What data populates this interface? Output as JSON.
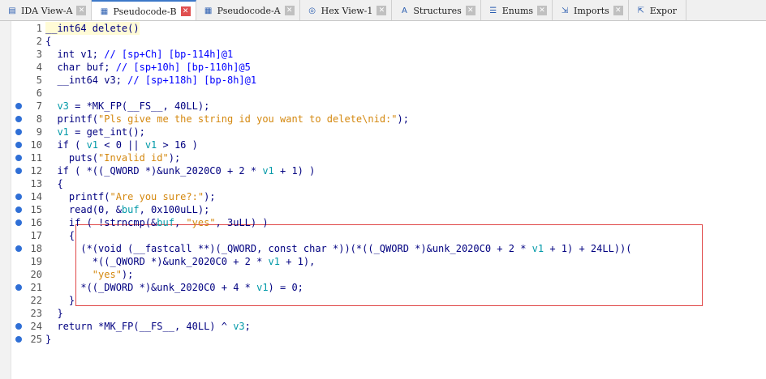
{
  "tabs": [
    {
      "label": "IDA View-A",
      "icon": "ida-view-icon",
      "glyph": "▤",
      "active": false
    },
    {
      "label": "Pseudocode-B",
      "icon": "pseudocode-icon",
      "glyph": "▦",
      "active": true
    },
    {
      "label": "Pseudocode-A",
      "icon": "pseudocode-icon",
      "glyph": "▦",
      "active": false
    },
    {
      "label": "Hex View-1",
      "icon": "hex-view-icon",
      "glyph": "◎",
      "active": false
    },
    {
      "label": "Structures",
      "icon": "structures-icon",
      "glyph": "A",
      "active": false
    },
    {
      "label": "Enums",
      "icon": "enums-icon",
      "glyph": "☰",
      "active": false
    },
    {
      "label": "Imports",
      "icon": "imports-icon",
      "glyph": "⇲",
      "active": false
    },
    {
      "label": "Expor",
      "icon": "exports-icon",
      "glyph": "⇱",
      "active": false
    }
  ],
  "tab_close_glyph": "✕",
  "code_lines": [
    {
      "n": "1",
      "dot": false,
      "cur": true,
      "segs": [
        [
          "typ",
          "__int64 delete()"
        ]
      ]
    },
    {
      "n": "2",
      "dot": false,
      "segs": [
        [
          "kw",
          "{"
        ]
      ]
    },
    {
      "n": "3",
      "dot": false,
      "segs": [
        [
          "typ",
          "  int v1; "
        ],
        [
          "cmt",
          "// [sp+Ch] [bp-114h]@1"
        ]
      ]
    },
    {
      "n": "4",
      "dot": false,
      "segs": [
        [
          "typ",
          "  char buf; "
        ],
        [
          "cmt",
          "// [sp+10h] [bp-110h]@5"
        ]
      ]
    },
    {
      "n": "5",
      "dot": false,
      "segs": [
        [
          "typ",
          "  __int64 v3; "
        ],
        [
          "cmt",
          "// [sp+118h] [bp-8h]@1"
        ]
      ]
    },
    {
      "n": "6",
      "dot": false,
      "segs": [
        [
          "kw",
          ""
        ]
      ]
    },
    {
      "n": "7",
      "dot": true,
      "segs": [
        [
          "kw",
          "  "
        ],
        [
          "var",
          "v3"
        ],
        [
          "kw",
          " = *MK_FP(__FS__, 40LL);"
        ]
      ]
    },
    {
      "n": "8",
      "dot": true,
      "segs": [
        [
          "kw",
          "  printf("
        ],
        [
          "str",
          "\"Pls give me the string id you want to delete\\nid:\""
        ],
        [
          "kw",
          ");"
        ]
      ]
    },
    {
      "n": "9",
      "dot": true,
      "segs": [
        [
          "kw",
          "  "
        ],
        [
          "var",
          "v1"
        ],
        [
          "kw",
          " = get_int();"
        ]
      ]
    },
    {
      "n": "10",
      "dot": true,
      "segs": [
        [
          "kw",
          "  if ( "
        ],
        [
          "var",
          "v1"
        ],
        [
          "kw",
          " < 0 || "
        ],
        [
          "var",
          "v1"
        ],
        [
          "kw",
          " > 16 )"
        ]
      ]
    },
    {
      "n": "11",
      "dot": true,
      "segs": [
        [
          "kw",
          "    puts("
        ],
        [
          "str",
          "\"Invalid id\""
        ],
        [
          "kw",
          ");"
        ]
      ]
    },
    {
      "n": "12",
      "dot": true,
      "segs": [
        [
          "kw",
          "  if ( *((_QWORD *)&unk_2020C0 + 2 * "
        ],
        [
          "var",
          "v1"
        ],
        [
          "kw",
          " + 1) )"
        ]
      ]
    },
    {
      "n": "13",
      "dot": false,
      "segs": [
        [
          "kw",
          "  {"
        ]
      ]
    },
    {
      "n": "14",
      "dot": true,
      "segs": [
        [
          "kw",
          "    printf("
        ],
        [
          "str",
          "\"Are you sure?:\""
        ],
        [
          "kw",
          ");"
        ]
      ]
    },
    {
      "n": "15",
      "dot": true,
      "segs": [
        [
          "kw",
          "    read(0, &"
        ],
        [
          "var",
          "buf"
        ],
        [
          "kw",
          ", 0x100uLL);"
        ]
      ]
    },
    {
      "n": "16",
      "dot": true,
      "segs": [
        [
          "kw",
          "    if ( !strncmp(&"
        ],
        [
          "var",
          "buf"
        ],
        [
          "kw",
          ", "
        ],
        [
          "str",
          "\"yes\""
        ],
        [
          "kw",
          ", 3uLL) )"
        ]
      ]
    },
    {
      "n": "17",
      "dot": false,
      "segs": [
        [
          "kw",
          "    {"
        ]
      ]
    },
    {
      "n": "18",
      "dot": true,
      "segs": [
        [
          "kw",
          "      (*(void (__fastcall **)(_QWORD, const char *))(*((_QWORD *)&unk_2020C0 + 2 * "
        ],
        [
          "var",
          "v1"
        ],
        [
          "kw",
          " + 1) + 24LL))("
        ]
      ]
    },
    {
      "n": "19",
      "dot": false,
      "segs": [
        [
          "kw",
          "        *((_QWORD *)&unk_2020C0 + 2 * "
        ],
        [
          "var",
          "v1"
        ],
        [
          "kw",
          " + 1),"
        ]
      ]
    },
    {
      "n": "20",
      "dot": false,
      "segs": [
        [
          "kw",
          "        "
        ],
        [
          "str",
          "\"yes\""
        ],
        [
          "kw",
          ");"
        ]
      ]
    },
    {
      "n": "21",
      "dot": true,
      "segs": [
        [
          "kw",
          "      *((_DWORD *)&unk_2020C0 + 4 * "
        ],
        [
          "var",
          "v1"
        ],
        [
          "kw",
          ") = 0;"
        ]
      ]
    },
    {
      "n": "22",
      "dot": false,
      "segs": [
        [
          "kw",
          "    }"
        ]
      ]
    },
    {
      "n": "23",
      "dot": false,
      "segs": [
        [
          "kw",
          "  }"
        ]
      ]
    },
    {
      "n": "24",
      "dot": true,
      "segs": [
        [
          "kw",
          "  return *MK_FP(__FS__, 40LL) ^ "
        ],
        [
          "var",
          "v3"
        ],
        [
          "kw",
          ";"
        ]
      ]
    },
    {
      "n": "25",
      "dot": true,
      "segs": [
        [
          "kw",
          "}"
        ]
      ]
    }
  ],
  "colors": {
    "accent": "#3c78c8",
    "keyword": "#000080",
    "string": "#d4880f",
    "variable": "#0099a8",
    "comment": "#0000ff",
    "breakpoint_dot": "#2f6fd6",
    "annotation_box": "#e04848"
  }
}
